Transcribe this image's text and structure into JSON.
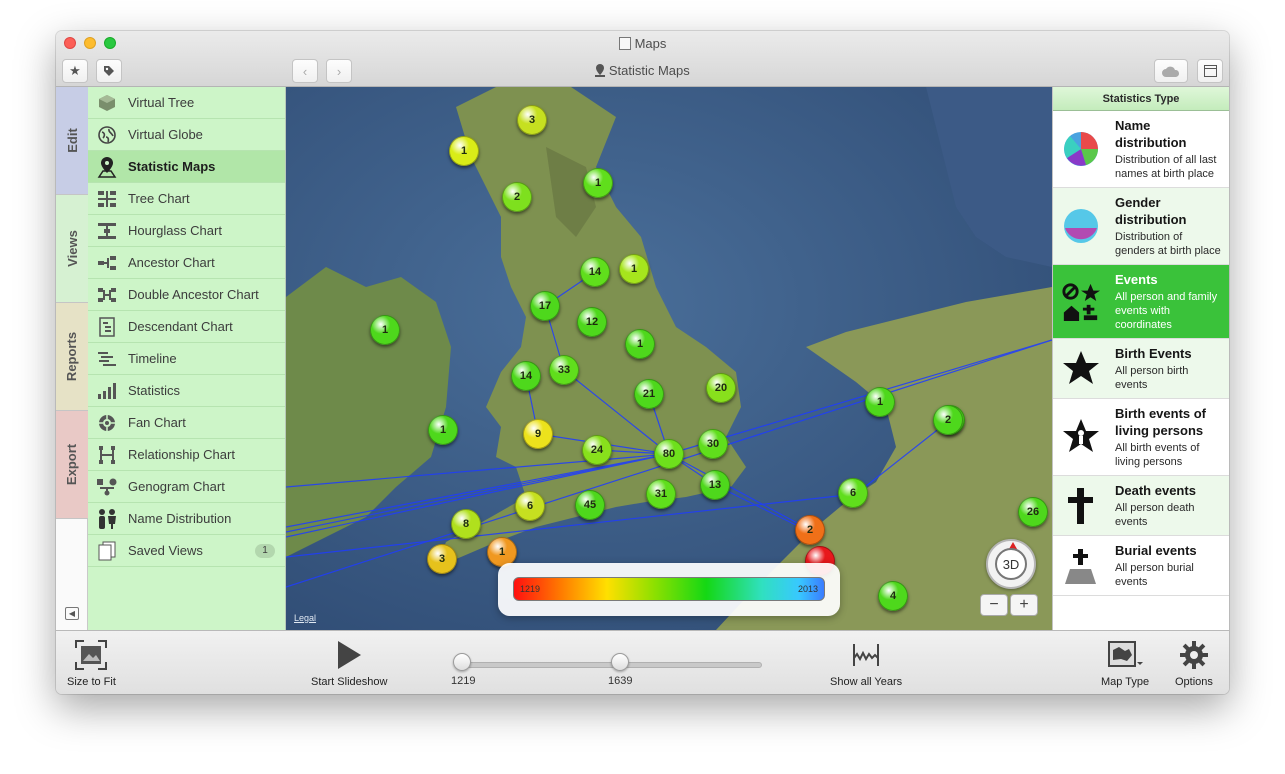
{
  "window": {
    "title": "Maps",
    "subtitle": "Statistic Maps"
  },
  "tabs": [
    {
      "label": "Edit",
      "color": "#c7cde6"
    },
    {
      "label": "Views",
      "color": "#d6f1d2"
    },
    {
      "label": "Reports",
      "color": "#e6e2c6"
    },
    {
      "label": "Export",
      "color": "#e9c9c6"
    }
  ],
  "sidebar": {
    "items": [
      {
        "label": "Virtual Tree",
        "icon": "virtual-tree-icon"
      },
      {
        "label": "Virtual Globe",
        "icon": "globe-icon"
      },
      {
        "label": "Statistic Maps",
        "icon": "map-pin-icon"
      },
      {
        "label": "Tree Chart",
        "icon": "tree-chart-icon"
      },
      {
        "label": "Hourglass Chart",
        "icon": "hourglass-chart-icon"
      },
      {
        "label": "Ancestor Chart",
        "icon": "ancestor-chart-icon"
      },
      {
        "label": "Double Ancestor Chart",
        "icon": "double-ancestor-chart-icon"
      },
      {
        "label": "Descendant Chart",
        "icon": "descendant-chart-icon"
      },
      {
        "label": "Timeline",
        "icon": "timeline-icon"
      },
      {
        "label": "Statistics",
        "icon": "statistics-icon"
      },
      {
        "label": "Fan Chart",
        "icon": "fan-chart-icon"
      },
      {
        "label": "Relationship Chart",
        "icon": "relationship-chart-icon"
      },
      {
        "label": "Genogram Chart",
        "icon": "genogram-chart-icon"
      },
      {
        "label": "Name Distribution",
        "icon": "name-distribution-icon"
      },
      {
        "label": "Saved Views",
        "icon": "saved-views-icon",
        "badge": "1"
      }
    ]
  },
  "map": {
    "legal": "Legal",
    "legend": {
      "min": "1219",
      "max": "2013"
    },
    "compass_label": "3D",
    "zoom_out": "−",
    "zoom_in": "+",
    "markers": [
      "3",
      "1",
      "2",
      "1",
      "14",
      "1",
      "17",
      "12",
      "1",
      "1",
      "14",
      "33",
      "21",
      "20",
      "1",
      "9",
      "24",
      "80",
      "30",
      "1",
      "2",
      "13",
      "31",
      "45",
      "6",
      "8",
      "1",
      "3",
      "6",
      "2",
      "2",
      "26",
      "4"
    ]
  },
  "stats_panel": {
    "header": "Statistics Type",
    "items": [
      {
        "title": "Name distribution",
        "desc": "Distribution of all last names at birth place",
        "icon": "pie-chart-icon"
      },
      {
        "title": "Gender distribution",
        "desc": "Distribution of genders at birth place",
        "icon": "gender-pie-icon"
      },
      {
        "title": "Events",
        "desc": "All person and family events with coordinates",
        "icon": "events-icon"
      },
      {
        "title": "Birth Events",
        "desc": "All person birth events",
        "icon": "star-icon"
      },
      {
        "title": "Birth events of living persons",
        "desc": "All birth events of living persons",
        "icon": "star-person-icon"
      },
      {
        "title": "Death events",
        "desc": "All person death events",
        "icon": "cross-icon"
      },
      {
        "title": "Burial events",
        "desc": "All person burial events",
        "icon": "grave-icon"
      }
    ]
  },
  "bottom": {
    "size_to_fit": "Size to Fit",
    "start_slideshow": "Start Slideshow",
    "slider_min": "1219",
    "slider_value": "1639",
    "slider_fraction": 0.53,
    "show_all_years": "Show all Years",
    "map_type": "Map Type",
    "options": "Options"
  }
}
